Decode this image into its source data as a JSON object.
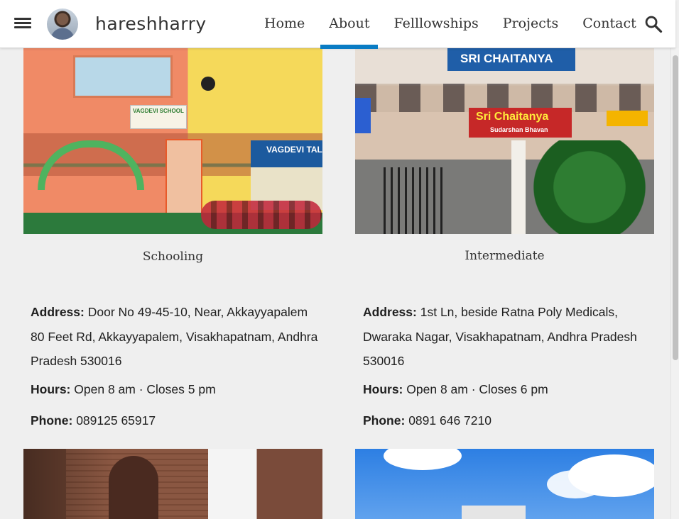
{
  "header": {
    "site_title": "hareshharry",
    "menu_icon": "hamburger-menu-icon",
    "search_icon": "search-icon",
    "nav": [
      {
        "label": "Home"
      },
      {
        "label": "About",
        "active": true
      },
      {
        "label": "Felllowships"
      },
      {
        "label": "Projects"
      },
      {
        "label": "Contact"
      }
    ],
    "active_color": "#0a7cc4"
  },
  "photos": {
    "school_sign": "VAGDEVI SCHOOL",
    "school_banner": "VAGDEVI TALENT",
    "intermediate_top_sign": "SRI CHAITANYA",
    "intermediate_sign": "Sri Chaitanya",
    "intermediate_sign_sub": "Sudarshan Bhavan"
  },
  "cards": [
    {
      "caption": "Schooling",
      "address_label": "Address:",
      "address_value": "Door No 49-45-10, Near, Akkayyapalem 80 Feet Rd, Akkayyapalem, Visakhapatnam, Andhra Pradesh 530016",
      "hours_label": "Hours:",
      "hours_value": "Open 8 am · Closes 5 pm",
      "phone_label": "Phone:",
      "phone_value": "089125 65917"
    },
    {
      "caption": "Intermediate",
      "address_label": "Address:",
      "address_value": "1st Ln, beside Ratna Poly Medicals, Dwaraka Nagar, Visakhapatnam, Andhra Pradesh 530016",
      "hours_label": "Hours:",
      "hours_value": "Open 8 am · Closes 6 pm",
      "phone_label": "Phone:",
      "phone_value": "0891 646 7210"
    }
  ]
}
